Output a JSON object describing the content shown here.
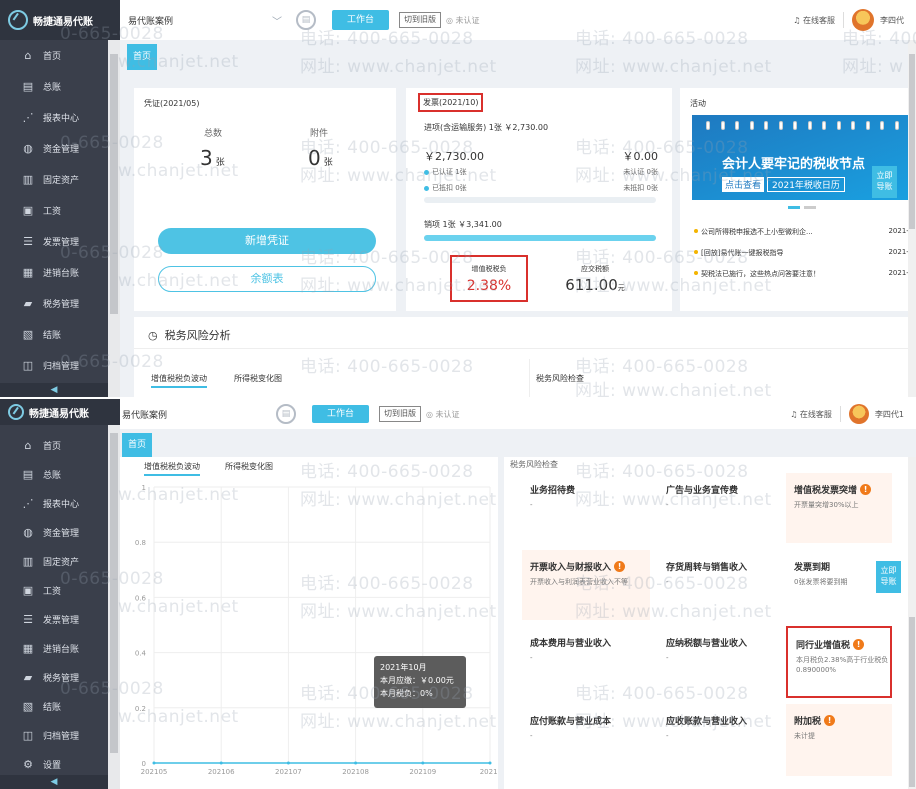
{
  "app": {
    "brand": "畅捷通易代账",
    "account_name": "易代账案例",
    "workbench_label": "工作台",
    "switch_label": "切到旧版",
    "unverified_label": "未认证",
    "service_label": "在线客服",
    "user_name_1": "李四代",
    "user_name_2": "李四代1",
    "home_tab": "首页",
    "collapse_glyph": "◀"
  },
  "sidebar": {
    "items": [
      {
        "label": "首页",
        "icon": "home-icon",
        "glyph": "⌂"
      },
      {
        "label": "总账",
        "icon": "ledger-icon",
        "glyph": "▤"
      },
      {
        "label": "报表中心",
        "icon": "chart-icon",
        "glyph": "⋰"
      },
      {
        "label": "资金管理",
        "icon": "fund-icon",
        "glyph": "◍"
      },
      {
        "label": "固定资产",
        "icon": "asset-icon",
        "glyph": "▥"
      },
      {
        "label": "工资",
        "icon": "salary-icon",
        "glyph": "▣"
      },
      {
        "label": "发票管理",
        "icon": "invoice-icon",
        "glyph": "☰"
      },
      {
        "label": "进销台账",
        "icon": "stock-icon",
        "glyph": "▦"
      },
      {
        "label": "税务管理",
        "icon": "tax-icon",
        "glyph": "▰"
      },
      {
        "label": "结账",
        "icon": "checkout-icon",
        "glyph": "▧"
      },
      {
        "label": "归档管理",
        "icon": "archive-icon",
        "glyph": "◫"
      },
      {
        "label": "设置",
        "icon": "settings-icon",
        "glyph": "⚙"
      }
    ]
  },
  "watermark": {
    "phone": "电话: 400-665-0028",
    "site": "网址: www.chanjet.net",
    "frag_phone": "0-665-0028",
    "frag_site": "w.chanjet.net",
    "frag_phone_short": "电话: 400-",
    "frag_site_short": "网址: w"
  },
  "voucher": {
    "title": "凭证(2021/05)",
    "total_label": "总数",
    "total_value": "3",
    "attach_label": "附件",
    "attach_value": "0",
    "unit": "张",
    "new_button": "新增凭证",
    "balance_button": "余额表"
  },
  "invoice": {
    "title": "发票(2021/10)",
    "input_summary": "进项(含运输服务) 1张 ￥2,730.00",
    "input_amount": "￥2,730.00",
    "input_tax": "￥0.00",
    "certified": "已认证 1张",
    "uncertified": "未认证 0张",
    "deducted": "已抵扣 0张",
    "undeducted": "未抵扣 0张",
    "sales_summary": "销项 1张 ￥3,341.00",
    "sales_progress": 1.0,
    "vat_burden_label": "增值税税负",
    "vat_burden_value": "2.38%",
    "tax_payable_label": "应交税额",
    "tax_payable_value": "611.00",
    "tax_payable_unit": "元"
  },
  "activity": {
    "title": "活动",
    "banner_title": "会计人要牢记的税收节点",
    "banner_btn": "点击查看",
    "banner_sub": "2021年税收日历",
    "quick_nav": [
      "立即",
      "导账"
    ],
    "news": [
      {
        "text": "公司所得税申报选不上小型微利企...",
        "date": "2021-1("
      },
      {
        "text": "[回放]易代账一键报税指导",
        "date": "2021-1("
      },
      {
        "text": "契税法已施行，这些热点问答要注意！",
        "date": "2021-1("
      }
    ]
  },
  "risk": {
    "title": "税务风险分析",
    "tabs": [
      "增值税税负波动",
      "所得税变化图"
    ],
    "check_title": "税务风险检查",
    "tiles": [
      {
        "title": "业务招待费",
        "desc": "-",
        "warn": false,
        "warm": false
      },
      {
        "title": "广告与业务宣传费",
        "desc": "-",
        "warn": false,
        "warm": false
      },
      {
        "title": "增值税发票突增",
        "desc": "开票量突增30%以上",
        "warn": true,
        "warm": true
      },
      {
        "title": "开票收入与财报收入",
        "desc": "开票收入与利润表营业收入不等",
        "warn": true,
        "warm": true
      },
      {
        "title": "存货周转与销售收入",
        "desc": "-",
        "warn": false,
        "warm": false
      },
      {
        "title": "发票到期",
        "desc": "0张发票将要到期",
        "warn": false,
        "warm": false
      },
      {
        "title": "成本费用与营业收入",
        "desc": "-",
        "warn": false,
        "warm": false
      },
      {
        "title": "应纳税额与营业收入",
        "desc": "-",
        "warn": false,
        "warm": false
      },
      {
        "title": "同行业增值税",
        "desc": "本月税负2.38%高于行业税负0.890000%",
        "warn": true,
        "warm": false
      },
      {
        "title": "应付账款与营业成本",
        "desc": "-",
        "warn": false,
        "warm": false
      },
      {
        "title": "应收账款与营业收入",
        "desc": "-",
        "warn": false,
        "warm": false
      },
      {
        "title": "附加税",
        "desc": "未计提",
        "warn": true,
        "warm": true
      }
    ]
  },
  "tooltip": {
    "month": "2021年10月",
    "payable": "本月应缴：￥0.00元",
    "burden": "本月税负：0%"
  },
  "chart_data": {
    "type": "line",
    "title": "",
    "xlabel": "",
    "ylabel": "",
    "x": [
      "202105",
      "202106",
      "202107",
      "202108",
      "202109",
      "2021("
    ],
    "yticks": [
      "0",
      "0.2",
      "0.4",
      "0.6",
      "0.8",
      "1"
    ],
    "ylim": [
      0,
      1
    ],
    "grid": true,
    "series": [
      {
        "values": [
          0,
          0,
          0,
          0,
          0,
          0
        ],
        "color": "#3fbde4"
      }
    ]
  }
}
